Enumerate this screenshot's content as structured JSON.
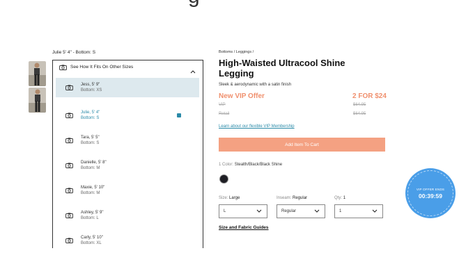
{
  "header": {
    "fragment": "g"
  },
  "fit_panel": {
    "caption": "Julie 5' 4\" - Bottom: S",
    "header_label": "See How It Fits On Other Sizes",
    "models": [
      {
        "name": "Jess, 5' 9\"",
        "bottom": "Bottom: XS"
      },
      {
        "name": "Julie, 5' 4\"",
        "bottom": "Bottom: S"
      },
      {
        "name": "Tara, 5' 5\"",
        "bottom": "Bottom: S"
      },
      {
        "name": "Danielle, 5' 8\"",
        "bottom": "Bottom: M"
      },
      {
        "name": "Maxie, 5' 10\"",
        "bottom": "Bottom: M"
      },
      {
        "name": "Ashley, 5' 9\"",
        "bottom": "Bottom: L"
      },
      {
        "name": "Carly, 5' 10\"",
        "bottom": "Bottom: XL"
      }
    ]
  },
  "product": {
    "breadcrumb": "Bottoms / Leggings /",
    "title": "High-Waisted Ultracool Shine Legging",
    "subtitle": "Sleek & aerodynamic with a satin finish",
    "offer_label": "New VIP Offer",
    "offer_value": "2 FOR $24",
    "vip_label": "VIP",
    "vip_price": "$64.95",
    "retail_label": "Retail",
    "retail_price": "$64.95",
    "learn_link": "Learn about our flexible VIP Membership",
    "cta": "Add Item To Cart",
    "color_label": "1 Color:",
    "color_value": "Stealth/Black/Black Shine",
    "size_label": "Size:",
    "size_value": "Large",
    "inseam_label": "Inseam:",
    "inseam_value": "Regular",
    "qty_label": "Qty:",
    "qty_value": "1",
    "size_select": "L",
    "inseam_select": "Regular",
    "qty_select": "1",
    "guides_link": "Size and Fabric Guides"
  },
  "vip_badge": {
    "label": "VIP OFFER ENDS",
    "timer": "00:39:59"
  },
  "colors": {
    "accent": "#f0906e",
    "cta": "#f4a182",
    "link": "#2a8aa8",
    "badge": "#4a9ee8",
    "selected_bg": "#dde9ee"
  }
}
